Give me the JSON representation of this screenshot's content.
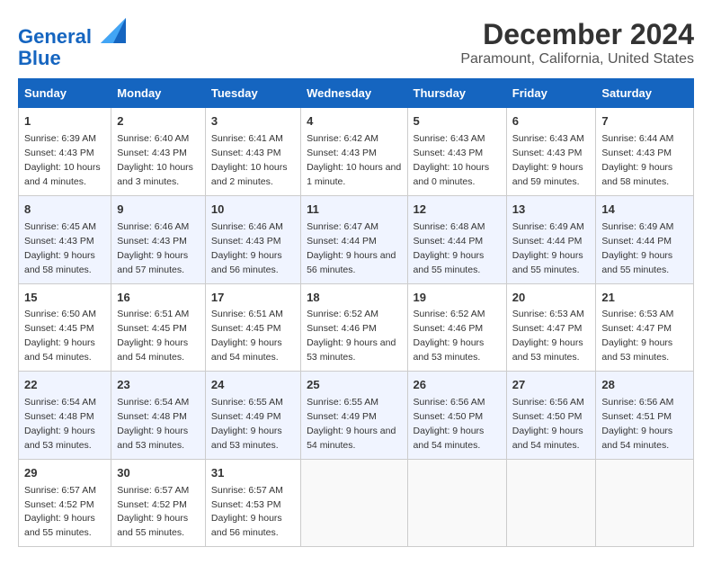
{
  "logo": {
    "line1": "General",
    "line2": "Blue"
  },
  "title": "December 2024",
  "subtitle": "Paramount, California, United States",
  "days_of_week": [
    "Sunday",
    "Monday",
    "Tuesday",
    "Wednesday",
    "Thursday",
    "Friday",
    "Saturday"
  ],
  "weeks": [
    [
      {
        "day": "1",
        "sunrise": "Sunrise: 6:39 AM",
        "sunset": "Sunset: 4:43 PM",
        "daylight": "Daylight: 10 hours and 4 minutes."
      },
      {
        "day": "2",
        "sunrise": "Sunrise: 6:40 AM",
        "sunset": "Sunset: 4:43 PM",
        "daylight": "Daylight: 10 hours and 3 minutes."
      },
      {
        "day": "3",
        "sunrise": "Sunrise: 6:41 AM",
        "sunset": "Sunset: 4:43 PM",
        "daylight": "Daylight: 10 hours and 2 minutes."
      },
      {
        "day": "4",
        "sunrise": "Sunrise: 6:42 AM",
        "sunset": "Sunset: 4:43 PM",
        "daylight": "Daylight: 10 hours and 1 minute."
      },
      {
        "day": "5",
        "sunrise": "Sunrise: 6:43 AM",
        "sunset": "Sunset: 4:43 PM",
        "daylight": "Daylight: 10 hours and 0 minutes."
      },
      {
        "day": "6",
        "sunrise": "Sunrise: 6:43 AM",
        "sunset": "Sunset: 4:43 PM",
        "daylight": "Daylight: 9 hours and 59 minutes."
      },
      {
        "day": "7",
        "sunrise": "Sunrise: 6:44 AM",
        "sunset": "Sunset: 4:43 PM",
        "daylight": "Daylight: 9 hours and 58 minutes."
      }
    ],
    [
      {
        "day": "8",
        "sunrise": "Sunrise: 6:45 AM",
        "sunset": "Sunset: 4:43 PM",
        "daylight": "Daylight: 9 hours and 58 minutes."
      },
      {
        "day": "9",
        "sunrise": "Sunrise: 6:46 AM",
        "sunset": "Sunset: 4:43 PM",
        "daylight": "Daylight: 9 hours and 57 minutes."
      },
      {
        "day": "10",
        "sunrise": "Sunrise: 6:46 AM",
        "sunset": "Sunset: 4:43 PM",
        "daylight": "Daylight: 9 hours and 56 minutes."
      },
      {
        "day": "11",
        "sunrise": "Sunrise: 6:47 AM",
        "sunset": "Sunset: 4:44 PM",
        "daylight": "Daylight: 9 hours and 56 minutes."
      },
      {
        "day": "12",
        "sunrise": "Sunrise: 6:48 AM",
        "sunset": "Sunset: 4:44 PM",
        "daylight": "Daylight: 9 hours and 55 minutes."
      },
      {
        "day": "13",
        "sunrise": "Sunrise: 6:49 AM",
        "sunset": "Sunset: 4:44 PM",
        "daylight": "Daylight: 9 hours and 55 minutes."
      },
      {
        "day": "14",
        "sunrise": "Sunrise: 6:49 AM",
        "sunset": "Sunset: 4:44 PM",
        "daylight": "Daylight: 9 hours and 55 minutes."
      }
    ],
    [
      {
        "day": "15",
        "sunrise": "Sunrise: 6:50 AM",
        "sunset": "Sunset: 4:45 PM",
        "daylight": "Daylight: 9 hours and 54 minutes."
      },
      {
        "day": "16",
        "sunrise": "Sunrise: 6:51 AM",
        "sunset": "Sunset: 4:45 PM",
        "daylight": "Daylight: 9 hours and 54 minutes."
      },
      {
        "day": "17",
        "sunrise": "Sunrise: 6:51 AM",
        "sunset": "Sunset: 4:45 PM",
        "daylight": "Daylight: 9 hours and 54 minutes."
      },
      {
        "day": "18",
        "sunrise": "Sunrise: 6:52 AM",
        "sunset": "Sunset: 4:46 PM",
        "daylight": "Daylight: 9 hours and 53 minutes."
      },
      {
        "day": "19",
        "sunrise": "Sunrise: 6:52 AM",
        "sunset": "Sunset: 4:46 PM",
        "daylight": "Daylight: 9 hours and 53 minutes."
      },
      {
        "day": "20",
        "sunrise": "Sunrise: 6:53 AM",
        "sunset": "Sunset: 4:47 PM",
        "daylight": "Daylight: 9 hours and 53 minutes."
      },
      {
        "day": "21",
        "sunrise": "Sunrise: 6:53 AM",
        "sunset": "Sunset: 4:47 PM",
        "daylight": "Daylight: 9 hours and 53 minutes."
      }
    ],
    [
      {
        "day": "22",
        "sunrise": "Sunrise: 6:54 AM",
        "sunset": "Sunset: 4:48 PM",
        "daylight": "Daylight: 9 hours and 53 minutes."
      },
      {
        "day": "23",
        "sunrise": "Sunrise: 6:54 AM",
        "sunset": "Sunset: 4:48 PM",
        "daylight": "Daylight: 9 hours and 53 minutes."
      },
      {
        "day": "24",
        "sunrise": "Sunrise: 6:55 AM",
        "sunset": "Sunset: 4:49 PM",
        "daylight": "Daylight: 9 hours and 53 minutes."
      },
      {
        "day": "25",
        "sunrise": "Sunrise: 6:55 AM",
        "sunset": "Sunset: 4:49 PM",
        "daylight": "Daylight: 9 hours and 54 minutes."
      },
      {
        "day": "26",
        "sunrise": "Sunrise: 6:56 AM",
        "sunset": "Sunset: 4:50 PM",
        "daylight": "Daylight: 9 hours and 54 minutes."
      },
      {
        "day": "27",
        "sunrise": "Sunrise: 6:56 AM",
        "sunset": "Sunset: 4:50 PM",
        "daylight": "Daylight: 9 hours and 54 minutes."
      },
      {
        "day": "28",
        "sunrise": "Sunrise: 6:56 AM",
        "sunset": "Sunset: 4:51 PM",
        "daylight": "Daylight: 9 hours and 54 minutes."
      }
    ],
    [
      {
        "day": "29",
        "sunrise": "Sunrise: 6:57 AM",
        "sunset": "Sunset: 4:52 PM",
        "daylight": "Daylight: 9 hours and 55 minutes."
      },
      {
        "day": "30",
        "sunrise": "Sunrise: 6:57 AM",
        "sunset": "Sunset: 4:52 PM",
        "daylight": "Daylight: 9 hours and 55 minutes."
      },
      {
        "day": "31",
        "sunrise": "Sunrise: 6:57 AM",
        "sunset": "Sunset: 4:53 PM",
        "daylight": "Daylight: 9 hours and 56 minutes."
      },
      null,
      null,
      null,
      null
    ]
  ]
}
